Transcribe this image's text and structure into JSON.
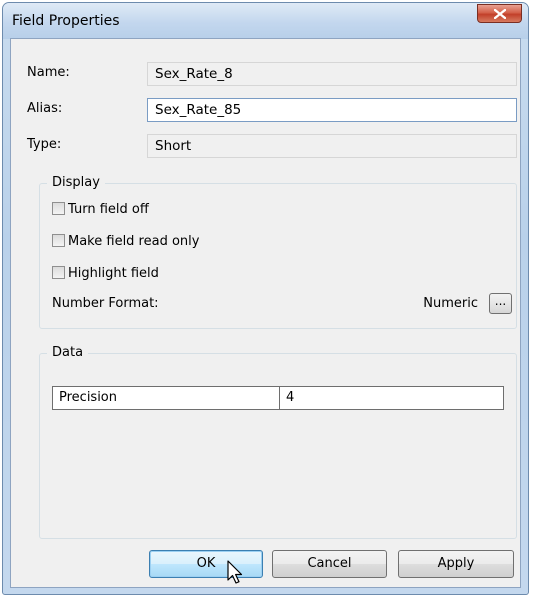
{
  "window": {
    "title": "Field Properties"
  },
  "fields": {
    "name_label": "Name:",
    "name_value": "Sex_Rate_8",
    "alias_label": "Alias:",
    "alias_value": "Sex_Rate_85",
    "type_label": "Type:",
    "type_value": "Short"
  },
  "display": {
    "legend": "Display",
    "turn_field_off": "Turn field off",
    "read_only": "Make field read only",
    "highlight": "Highlight field",
    "number_format_label": "Number Format:",
    "number_format_value": "Numeric",
    "ellipsis_label": "..."
  },
  "data_group": {
    "legend": "Data",
    "rows": [
      {
        "property": "Precision",
        "value": "4"
      }
    ]
  },
  "buttons": {
    "ok": "OK",
    "cancel": "Cancel",
    "apply": "Apply"
  },
  "colors": {
    "title_bar": "#c3d7ee",
    "close_button": "#c2402a",
    "dialog_face": "#f0f0f0",
    "default_button": "#bee6fd"
  },
  "icons": {
    "close": "close-icon",
    "cursor": "mouse-pointer-icon"
  }
}
